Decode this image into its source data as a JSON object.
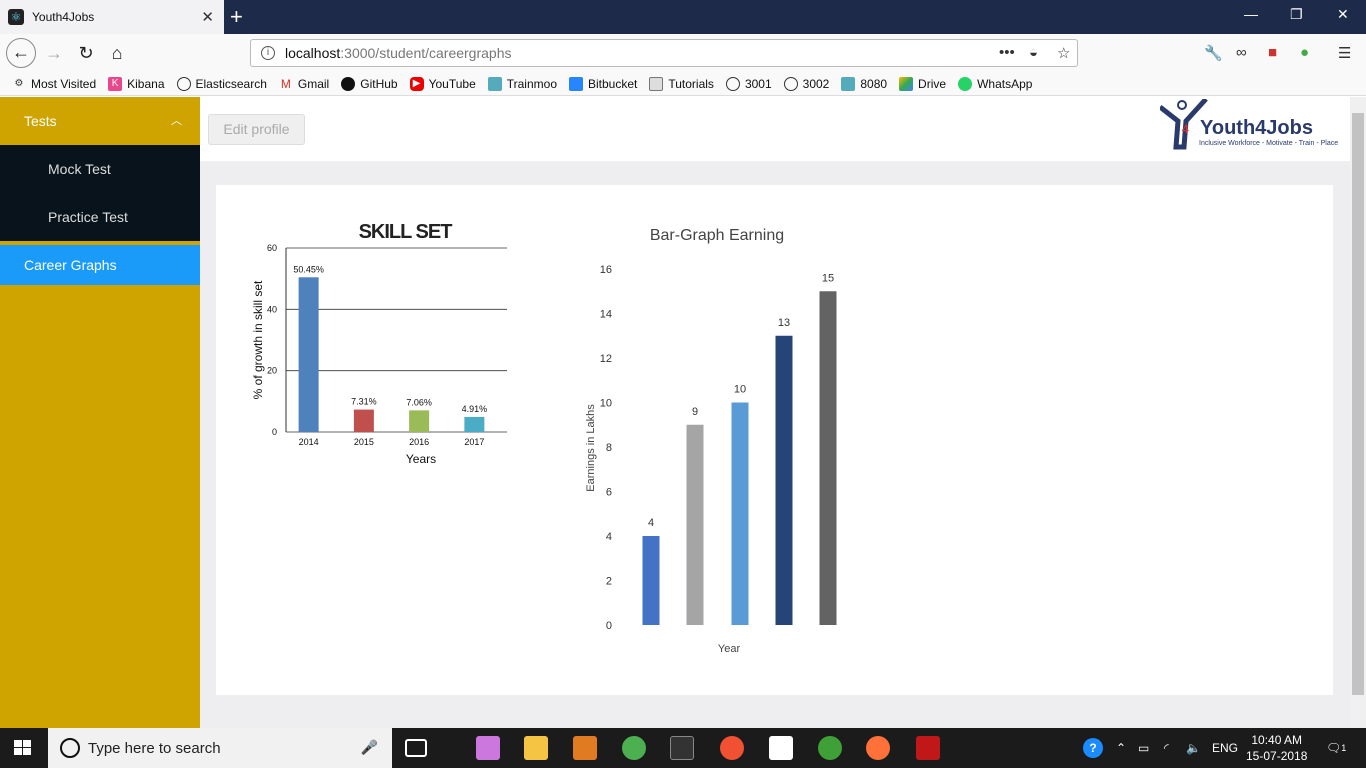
{
  "browser": {
    "tab_title": "Youth4Jobs",
    "url_host": "localhost",
    "url_path": ":3000/student/careergraphs",
    "bookmarks": [
      "Most Visited",
      "Kibana",
      "Elasticsearch",
      "Gmail",
      "GitHub",
      "YouTube",
      "Trainmoo",
      "Bitbucket",
      "Tutorials",
      "3001",
      "3002",
      "8080",
      "Drive",
      "WhatsApp"
    ]
  },
  "sidebar": {
    "section": "Tests",
    "items": [
      "Mock Test",
      "Practice Test"
    ],
    "active": "Career Graphs"
  },
  "header": {
    "edit_profile": "Edit profile",
    "logo_text": "Youth4Jobs",
    "logo_tagline": "Inclusive Workforce - Motivate - Train - Place",
    "logo_digit": "4"
  },
  "chart_data": [
    {
      "type": "bar",
      "title": "SKILL SET",
      "xlabel": "Years",
      "ylabel": "% of growth in skill set",
      "categories": [
        "2014",
        "2015",
        "2016",
        "2017"
      ],
      "values": [
        50.45,
        7.31,
        7.06,
        4.91
      ],
      "data_labels": [
        "50.45%",
        "7.31%",
        "7.06%",
        "4.91%"
      ],
      "colors": [
        "#4f81bd",
        "#c0504d",
        "#9bbb59",
        "#4bacc6"
      ],
      "ylim": [
        0,
        60
      ],
      "yticks": [
        "0",
        "20",
        "40",
        "60"
      ],
      "grid": true
    },
    {
      "type": "bar",
      "title": "Bar-Graph Earning",
      "xlabel": "Year",
      "ylabel": "Earnings in Lakhs",
      "categories": [
        "",
        "",
        "",
        "",
        ""
      ],
      "values": [
        4,
        9,
        10,
        13,
        15
      ],
      "colors": [
        "#4472c4",
        "#a5a5a5",
        "#5b9bd5",
        "#264478",
        "#636363"
      ],
      "ylim": [
        0,
        16
      ],
      "yticks": [
        "0",
        "2",
        "4",
        "6",
        "8",
        "10",
        "12",
        "14",
        "16"
      ],
      "grid": false
    }
  ],
  "taskbar": {
    "search_placeholder": "Type here to search",
    "language": "ENG",
    "time": "10:40 AM",
    "date": "15-07-2018",
    "notifications": "1"
  }
}
